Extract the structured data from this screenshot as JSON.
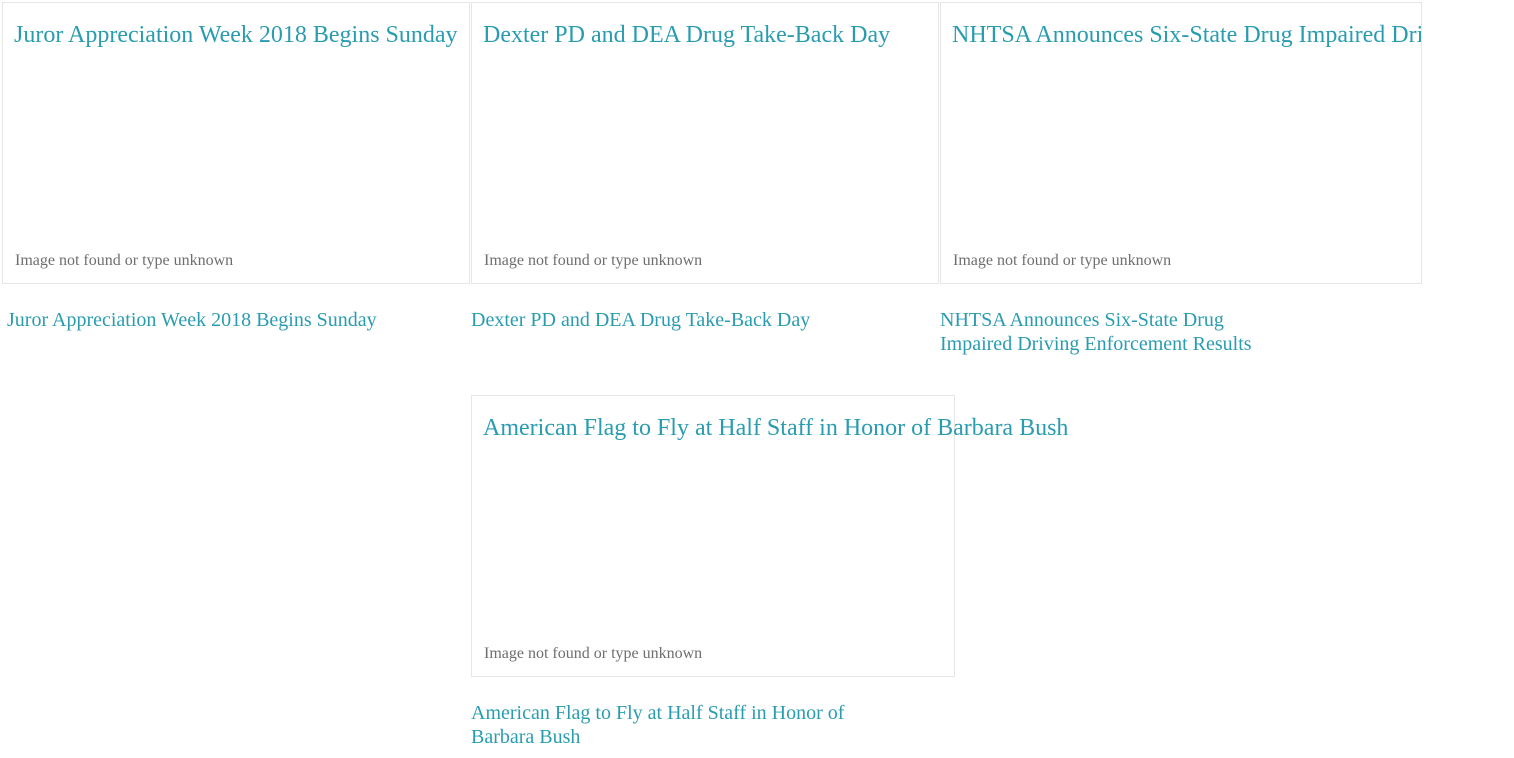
{
  "articles": [
    {
      "image_alt": "Juror Appreciation Week 2018 Begins Sunday",
      "image_fallback": "Image not found or type unknown",
      "title": "Juror Appreciation Week 2018 Begins Sunday"
    },
    {
      "image_alt": "Dexter PD and DEA Drug Take-Back Day",
      "image_fallback": "Image not found or type unknown",
      "title": "Dexter PD and DEA Drug Take-Back Day"
    },
    {
      "image_alt": "NHTSA Announces Six-State Drug Impaired Driving Enforcement Results",
      "image_fallback": "Image not found or type unknown",
      "title": "NHTSA Announces Six-State Drug Impaired Driving Enforcement Results"
    },
    {
      "image_alt": "American Flag to Fly at Half Staff in Honor of Barbara Bush",
      "image_fallback": "Image not found or type unknown",
      "title": "American Flag to Fly at Half Staff in Honor of Barbara Bush"
    }
  ],
  "colors": {
    "link": "#2a9cb0",
    "fallback_text": "#6e6e6e",
    "thumb_border": "#e6e6e6"
  }
}
